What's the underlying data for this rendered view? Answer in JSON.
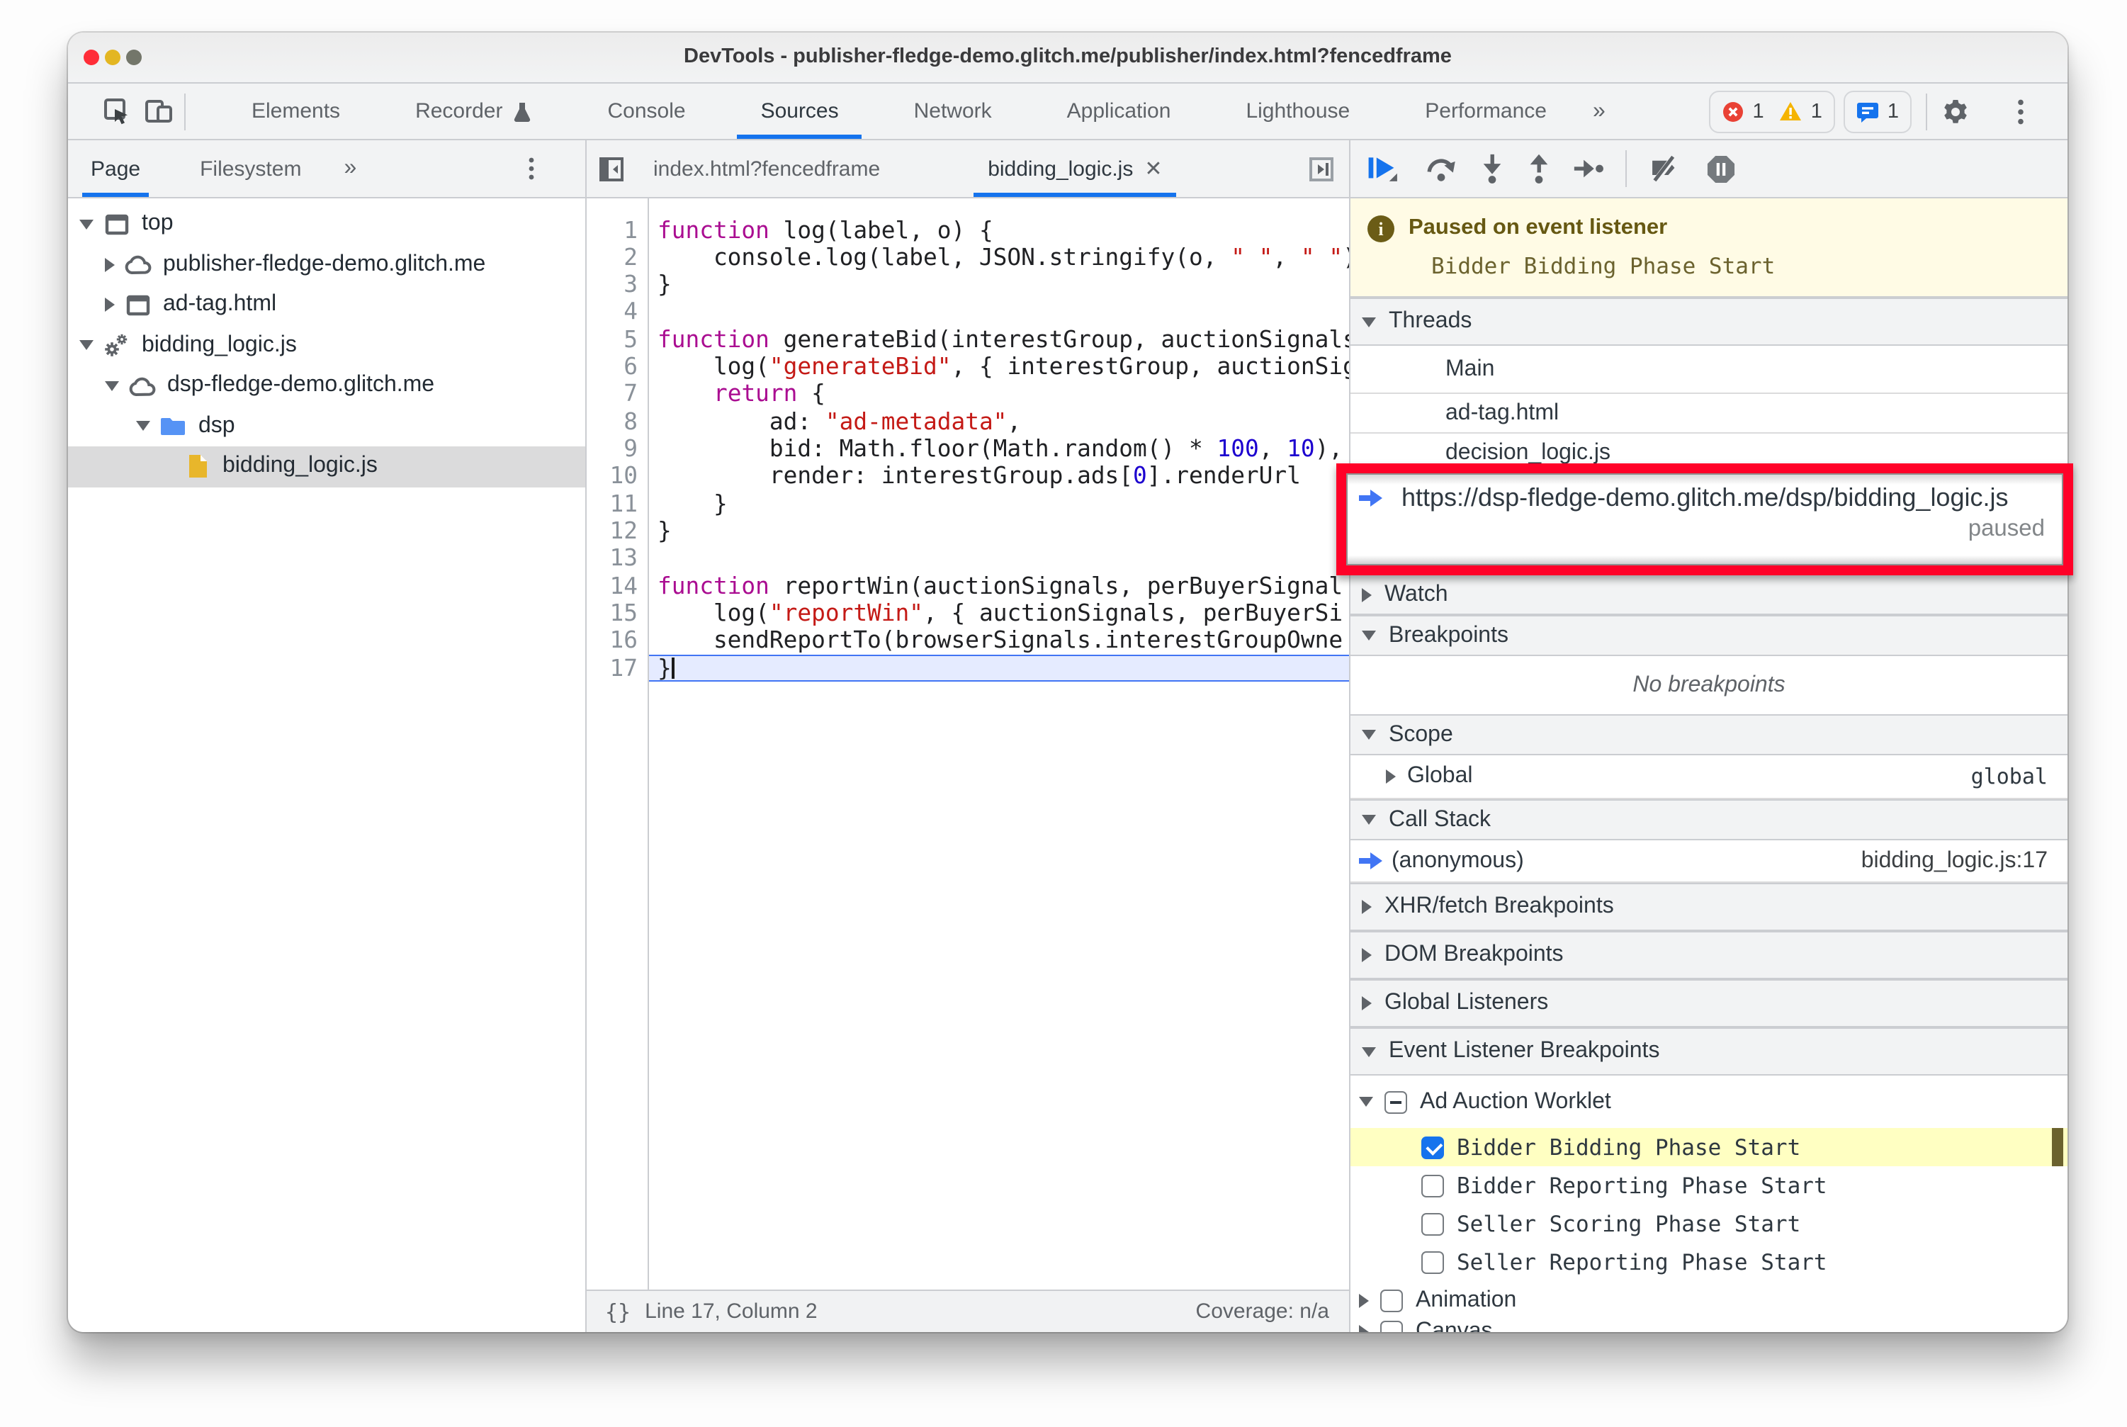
{
  "window": {
    "title": "DevTools - publisher-fledge-demo.glitch.me/publisher/index.html?fencedframe"
  },
  "toolbar": {
    "tabs": [
      {
        "label": "Elements"
      },
      {
        "label": "Recorder",
        "icon": "flask-icon"
      },
      {
        "label": "Console"
      },
      {
        "label": "Sources",
        "active": true
      },
      {
        "label": "Network"
      },
      {
        "label": "Application"
      },
      {
        "label": "Lighthouse"
      },
      {
        "label": "Performance"
      }
    ],
    "more": "»",
    "error_count": "1",
    "warning_count": "1",
    "issues_count": "1"
  },
  "sidebar": {
    "tabs": [
      {
        "label": "Page",
        "active": true
      },
      {
        "label": "Filesystem"
      }
    ],
    "more": "»",
    "tree": [
      {
        "label": "top",
        "icon": "frame",
        "tri": "down",
        "depth": 0
      },
      {
        "label": "publisher-fledge-demo.glitch.me",
        "icon": "cloud",
        "tri": "right",
        "depth": 1
      },
      {
        "label": "ad-tag.html",
        "icon": "frame",
        "tri": "right",
        "depth": 1
      },
      {
        "label": "bidding_logic.js",
        "icon": "gears",
        "tri": "down",
        "depth": 0
      },
      {
        "label": "dsp-fledge-demo.glitch.me",
        "icon": "cloud",
        "tri": "down",
        "depth": 1
      },
      {
        "label": "dsp",
        "icon": "folder",
        "tri": "down",
        "depth": 2
      },
      {
        "label": "bidding_logic.js",
        "icon": "file",
        "tri": "none",
        "depth": 3,
        "selected": true
      }
    ]
  },
  "editor": {
    "tabs": [
      {
        "label": "index.html?fencedframe"
      },
      {
        "label": "bidding_logic.js",
        "active": true,
        "closable": true
      }
    ],
    "lines": [
      {
        "n": 1,
        "tokens": [
          [
            "k",
            "function"
          ],
          [
            "t",
            " log(label, o) {"
          ]
        ]
      },
      {
        "n": 2,
        "tokens": [
          [
            "t",
            "    console.log(label, JSON.stringify(o, "
          ],
          [
            "s",
            "\" \""
          ],
          [
            "t",
            ", "
          ],
          [
            "s",
            "\" \""
          ],
          [
            "t",
            "));"
          ]
        ]
      },
      {
        "n": 3,
        "tokens": [
          [
            "t",
            "}"
          ]
        ]
      },
      {
        "n": 4,
        "tokens": []
      },
      {
        "n": 5,
        "tokens": [
          [
            "k",
            "function"
          ],
          [
            "t",
            " generateBid(interestGroup, auctionSignals, per"
          ]
        ]
      },
      {
        "n": 6,
        "tokens": [
          [
            "t",
            "    log("
          ],
          [
            "s",
            "\"generateBid\""
          ],
          [
            "t",
            ", { interestGroup, auctionSignals"
          ]
        ]
      },
      {
        "n": 7,
        "tokens": [
          [
            "t",
            "    "
          ],
          [
            "k",
            "return"
          ],
          [
            "t",
            " {"
          ]
        ]
      },
      {
        "n": 8,
        "tokens": [
          [
            "t",
            "        ad: "
          ],
          [
            "s",
            "\"ad-metadata\""
          ],
          [
            "t",
            ","
          ]
        ]
      },
      {
        "n": 9,
        "tokens": [
          [
            "t",
            "        bid: Math.floor(Math.random() * "
          ],
          [
            "n",
            "100"
          ],
          [
            "t",
            ", "
          ],
          [
            "n",
            "10"
          ],
          [
            "t",
            "),"
          ]
        ]
      },
      {
        "n": 10,
        "tokens": [
          [
            "t",
            "        render: interestGroup.ads["
          ],
          [
            "n",
            "0"
          ],
          [
            "t",
            "].renderUrl"
          ]
        ]
      },
      {
        "n": 11,
        "tokens": [
          [
            "t",
            "    }"
          ]
        ]
      },
      {
        "n": 12,
        "tokens": [
          [
            "t",
            "}"
          ]
        ]
      },
      {
        "n": 13,
        "tokens": []
      },
      {
        "n": 14,
        "tokens": [
          [
            "k",
            "function"
          ],
          [
            "t",
            " reportWin(auctionSignals, perBuyerSignal"
          ]
        ]
      },
      {
        "n": 15,
        "tokens": [
          [
            "t",
            "    log("
          ],
          [
            "s",
            "\"reportWin\""
          ],
          [
            "t",
            ", { auctionSignals, perBuyerSi"
          ]
        ]
      },
      {
        "n": 16,
        "tokens": [
          [
            "t",
            "    sendReportTo(browserSignals.interestGroupOwne"
          ]
        ]
      },
      {
        "n": 17,
        "tokens": [
          [
            "t",
            "}"
          ]
        ],
        "exec": true
      }
    ],
    "status": {
      "line_col": "Line 17, Column 2",
      "coverage": "Coverage: n/a",
      "braces": "{}"
    }
  },
  "debugger": {
    "paused_banner": {
      "title": "Paused on event listener",
      "subtitle": "Bidder Bidding Phase Start"
    },
    "threads": {
      "title": "Threads",
      "items": [
        {
          "label": "Main"
        },
        {
          "label": "ad-tag.html"
        },
        {
          "label": "decision_logic.js"
        }
      ]
    },
    "paused_thread": {
      "url": "https://dsp-fledge-demo.glitch.me/dsp/bidding_logic.js",
      "status": "paused"
    },
    "watch": {
      "title": "Watch"
    },
    "breakpoints": {
      "title": "Breakpoints",
      "empty": "No breakpoints"
    },
    "scope": {
      "title": "Scope",
      "rows": [
        {
          "label": "Global",
          "value": "global"
        }
      ]
    },
    "call_stack": {
      "title": "Call Stack",
      "rows": [
        {
          "label": "(anonymous)",
          "location": "bidding_logic.js:17"
        }
      ]
    },
    "xhr": {
      "title": "XHR/fetch Breakpoints"
    },
    "dom": {
      "title": "DOM Breakpoints"
    },
    "global_listeners": {
      "title": "Global Listeners"
    },
    "elb": {
      "title": "Event Listener Breakpoints",
      "group": {
        "label": "Ad Auction Worklet",
        "state": "indeterminate"
      },
      "children": [
        {
          "label": "Bidder Bidding Phase Start",
          "checked": true,
          "highlighted": true
        },
        {
          "label": "Bidder Reporting Phase Start",
          "checked": false
        },
        {
          "label": "Seller Scoring Phase Start",
          "checked": false
        },
        {
          "label": "Seller Reporting Phase Start",
          "checked": false
        }
      ],
      "others": [
        {
          "label": "Animation",
          "checked": false
        },
        {
          "label": "Canvas",
          "checked": false
        }
      ]
    }
  }
}
